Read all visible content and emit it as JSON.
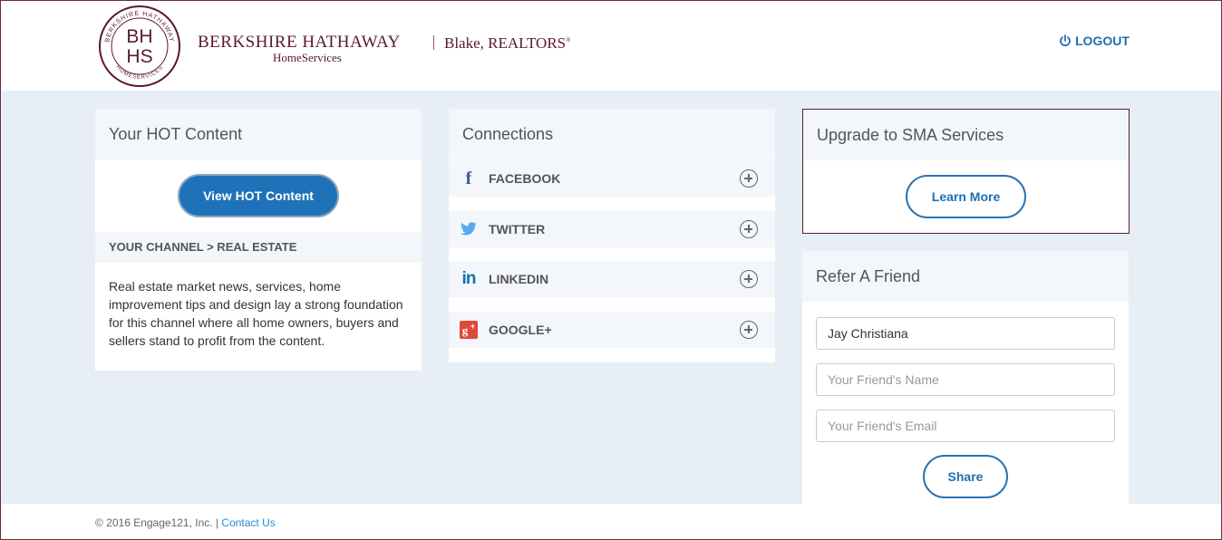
{
  "brand": {
    "seal_top": "BERKSHIRE HATHAWAY",
    "seal_bottom": "HOMESERVICES",
    "seal_line1": "BH",
    "seal_line2": "HS",
    "name": "BERKSHIRE HATHAWAY",
    "sub": "HomeServices",
    "agent": "Blake, REALTORS",
    "agent_mark": "®",
    "color": "#5a1a2b"
  },
  "header": {
    "logout_label": "LOGOUT",
    "logout_icon": "power-icon"
  },
  "hot_content": {
    "title": "Your HOT Content",
    "button_label": "View HOT Content",
    "channel": "YOUR CHANNEL > REAL ESTATE",
    "description": "Real estate market news, services, home improvement tips and design lay a strong foundation for this channel where all home owners, buyers and sellers stand to profit from the content."
  },
  "connections": {
    "title": "Connections",
    "items": [
      {
        "label": "FACEBOOK",
        "icon": "facebook-icon",
        "action_icon": "plus-circle-icon"
      },
      {
        "label": "TWITTER",
        "icon": "twitter-icon",
        "action_icon": "plus-circle-icon"
      },
      {
        "label": "LINKEDIN",
        "icon": "linkedin-icon",
        "action_icon": "plus-circle-icon"
      },
      {
        "label": "GOOGLE+",
        "icon": "google-plus-icon",
        "action_icon": "plus-circle-icon"
      }
    ]
  },
  "upgrade": {
    "title": "Upgrade to SMA Services",
    "button_label": "Learn More"
  },
  "refer": {
    "title": "Refer A Friend",
    "your_name_value": "Jay Christiana",
    "friend_name_placeholder": "Your Friend's Name",
    "friend_email_placeholder": "Your Friend's Email",
    "share_label": "Share"
  },
  "footer": {
    "copyright": "© 2016 Engage121, Inc. |",
    "contact_label": "Contact Us"
  },
  "colors": {
    "accent": "#1f72b8",
    "background": "#e8eef5",
    "panel_head": "#f3f6fa"
  }
}
